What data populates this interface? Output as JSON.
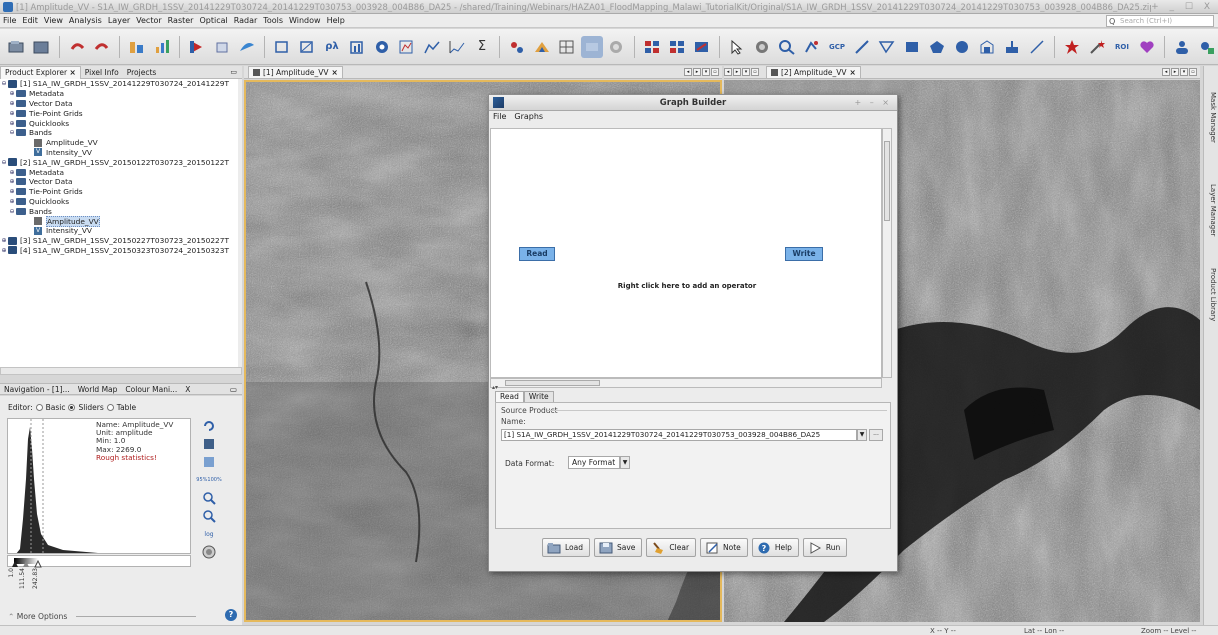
{
  "window": {
    "title": "[1] Amplitude_VV - S1A_IW_GRDH_1SSV_20141229T030724_20141229T030753_003928_004B86_DA25 - /shared/Training/Webinars/HAZA01_FloodMapping_Malawi_TutorialKit/Original/S1A_IW_GRDH_1SSV_20141229T030724_20141229T030753_003928_004B86_DA25.zip - SN",
    "controls": "+ _ ☐ X"
  },
  "menu": {
    "items": [
      "File",
      "Edit",
      "View",
      "Analysis",
      "Layer",
      "Vector",
      "Raster",
      "Optical",
      "Radar",
      "Tools",
      "Window",
      "Help"
    ],
    "search_placeholder": "Search (Ctrl+I)"
  },
  "toolbar": {
    "icons": [
      "new-product-icon",
      "open-product-icon",
      "undo-icon",
      "redo-icon",
      "session-icon",
      "band-maths-icon",
      "layer-icon",
      "vector-icon",
      "node-icon",
      "pin-icon",
      "view-icon",
      "draw-icon",
      "polyline-icon",
      "sigma-icon",
      "zoom-all-icon",
      "fit-icon",
      "graph-icon",
      "run-icon",
      "settings-icon",
      "grid-icon",
      "select-icon",
      "pan-icon",
      "zoom-icon",
      "gcp-icon",
      "line-icon",
      "polygon-icon",
      "rect-icon",
      "ellipse-icon",
      "pin-manager-icon",
      "range-icon",
      "star-icon",
      "wand-icon",
      "roi-icon",
      "heart-icon",
      "user-icon",
      "options-icon"
    ],
    "gcp_label": "GCP",
    "roi_label": "ROI"
  },
  "product_explorer": {
    "tabs": [
      "Product Explorer",
      "Pixel Info",
      "Projects"
    ],
    "products": [
      {
        "label": "[1] S1A_IW_GRDH_1SSV_20141229T030724_20141229T",
        "groups": [
          "Metadata",
          "Vector Data",
          "Tie-Point Grids",
          "Quicklooks",
          "Bands"
        ],
        "bands": [
          "Amplitude_VV",
          "Intensity_VV"
        ]
      },
      {
        "label": "[2] S1A_IW_GRDH_1SSV_20150122T030723_20150122T",
        "groups": [
          "Metadata",
          "Vector Data",
          "Tie-Point Grids",
          "Quicklooks",
          "Bands"
        ],
        "bands": [
          "Amplitude_VV",
          "Intensity_VV"
        ]
      },
      {
        "label": "[3] S1A_IW_GRDH_1SSV_20150227T030723_20150227T"
      },
      {
        "label": "[4] S1A_IW_GRDH_1SSV_20150323T030724_20150323T"
      }
    ],
    "band_v_icon": "V"
  },
  "navigation": {
    "tabs": [
      "Navigation - [1]...",
      "World Map",
      "Colour Mani...",
      "X"
    ],
    "editor_label": "Editor:",
    "modes": [
      "Basic",
      "Sliders",
      "Table"
    ],
    "selected_mode": "Sliders",
    "band_name": "Name: Amplitude_VV",
    "unit": "Unit: amplitude",
    "min": "Min: 1.0",
    "max": "Max: 2269.0",
    "rough": "Rough statistics!",
    "slider_labels": [
      "1.0",
      "111.54",
      "242.83"
    ],
    "pct_labels": [
      "95%",
      "100%"
    ],
    "more_options": "More Options"
  },
  "views": {
    "view1_tab": "[1] Amplitude_VV",
    "view2_tab": "[2] Amplitude_VV"
  },
  "rightbar": [
    "Mask Manager",
    "Layer Manager",
    "Product Library"
  ],
  "status": {
    "x": "X -- Y --",
    "lat": "Lat -- Lon --",
    "zoom": "Zoom -- Level --"
  },
  "graph_builder": {
    "title": "Graph Builder",
    "menu": [
      "File",
      "Graphs"
    ],
    "node_read": "Read",
    "node_write": "Write",
    "hint": "Right click here to add an operator",
    "tabs": [
      "Read",
      "Write"
    ],
    "source_product": "Source Product",
    "name_label": "Name:",
    "name_value": "[1] S1A_IW_GRDH_1SSV_20141229T030724_20141229T030753_003928_004B86_DA25",
    "data_format_label": "Data Format:",
    "data_format_value": "Any Format",
    "buttons": [
      "Load",
      "Save",
      "Clear",
      "Note",
      "Help",
      "Run"
    ]
  }
}
